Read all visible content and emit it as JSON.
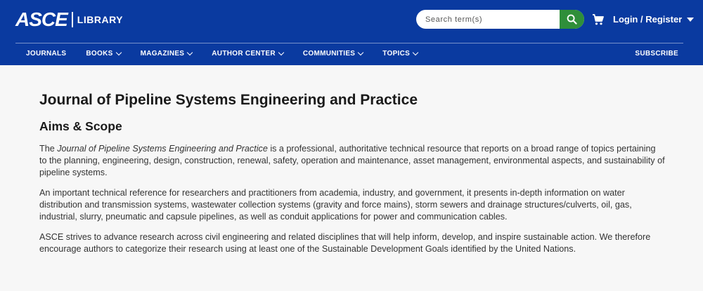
{
  "header": {
    "logo_mark": "ASCE",
    "logo_library": "LIBRARY",
    "search_placeholder": "Search term(s)",
    "login_label": "Login / Register"
  },
  "nav": {
    "items": [
      {
        "label": "JOURNALS",
        "has_dropdown": false
      },
      {
        "label": "BOOKS",
        "has_dropdown": true
      },
      {
        "label": "MAGAZINES",
        "has_dropdown": true
      },
      {
        "label": "AUTHOR CENTER",
        "has_dropdown": true
      },
      {
        "label": "COMMUNITIES",
        "has_dropdown": true
      },
      {
        "label": "TOPICS",
        "has_dropdown": true
      }
    ],
    "subscribe_label": "SUBSCRIBE"
  },
  "main": {
    "title": "Journal of Pipeline Systems Engineering and Practice",
    "section_title": "Aims & Scope",
    "p1_prefix": "The ",
    "p1_journal": "Journal of Pipeline Systems Engineering and Practice",
    "p1_rest": " is a professional, authoritative technical resource that reports on a broad range of topics pertaining to the planning, engineering, design, construction, renewal, safety, operation and maintenance, asset management, environmental aspects, and sustainability of pipeline systems.",
    "p2": "An important technical reference for researchers and practitioners from academia, industry, and government, it presents in-depth information on water distribution and transmission systems, wastewater collection systems (gravity and force mains), storm sewers and drainage structures/culverts, oil, gas, industrial, slurry, pneumatic and capsule pipelines, as well as conduit applications for power and communication cables.",
    "p3": "ASCE strives to advance research across civil engineering and related disciplines that will help inform, develop, and inspire sustainable action. We therefore encourage authors to categorize their research using at least one of the Sustainable Development Goals identified by the United Nations."
  },
  "colors": {
    "header_bg": "#0a3aa0",
    "search_button": "#2f8f3a"
  }
}
